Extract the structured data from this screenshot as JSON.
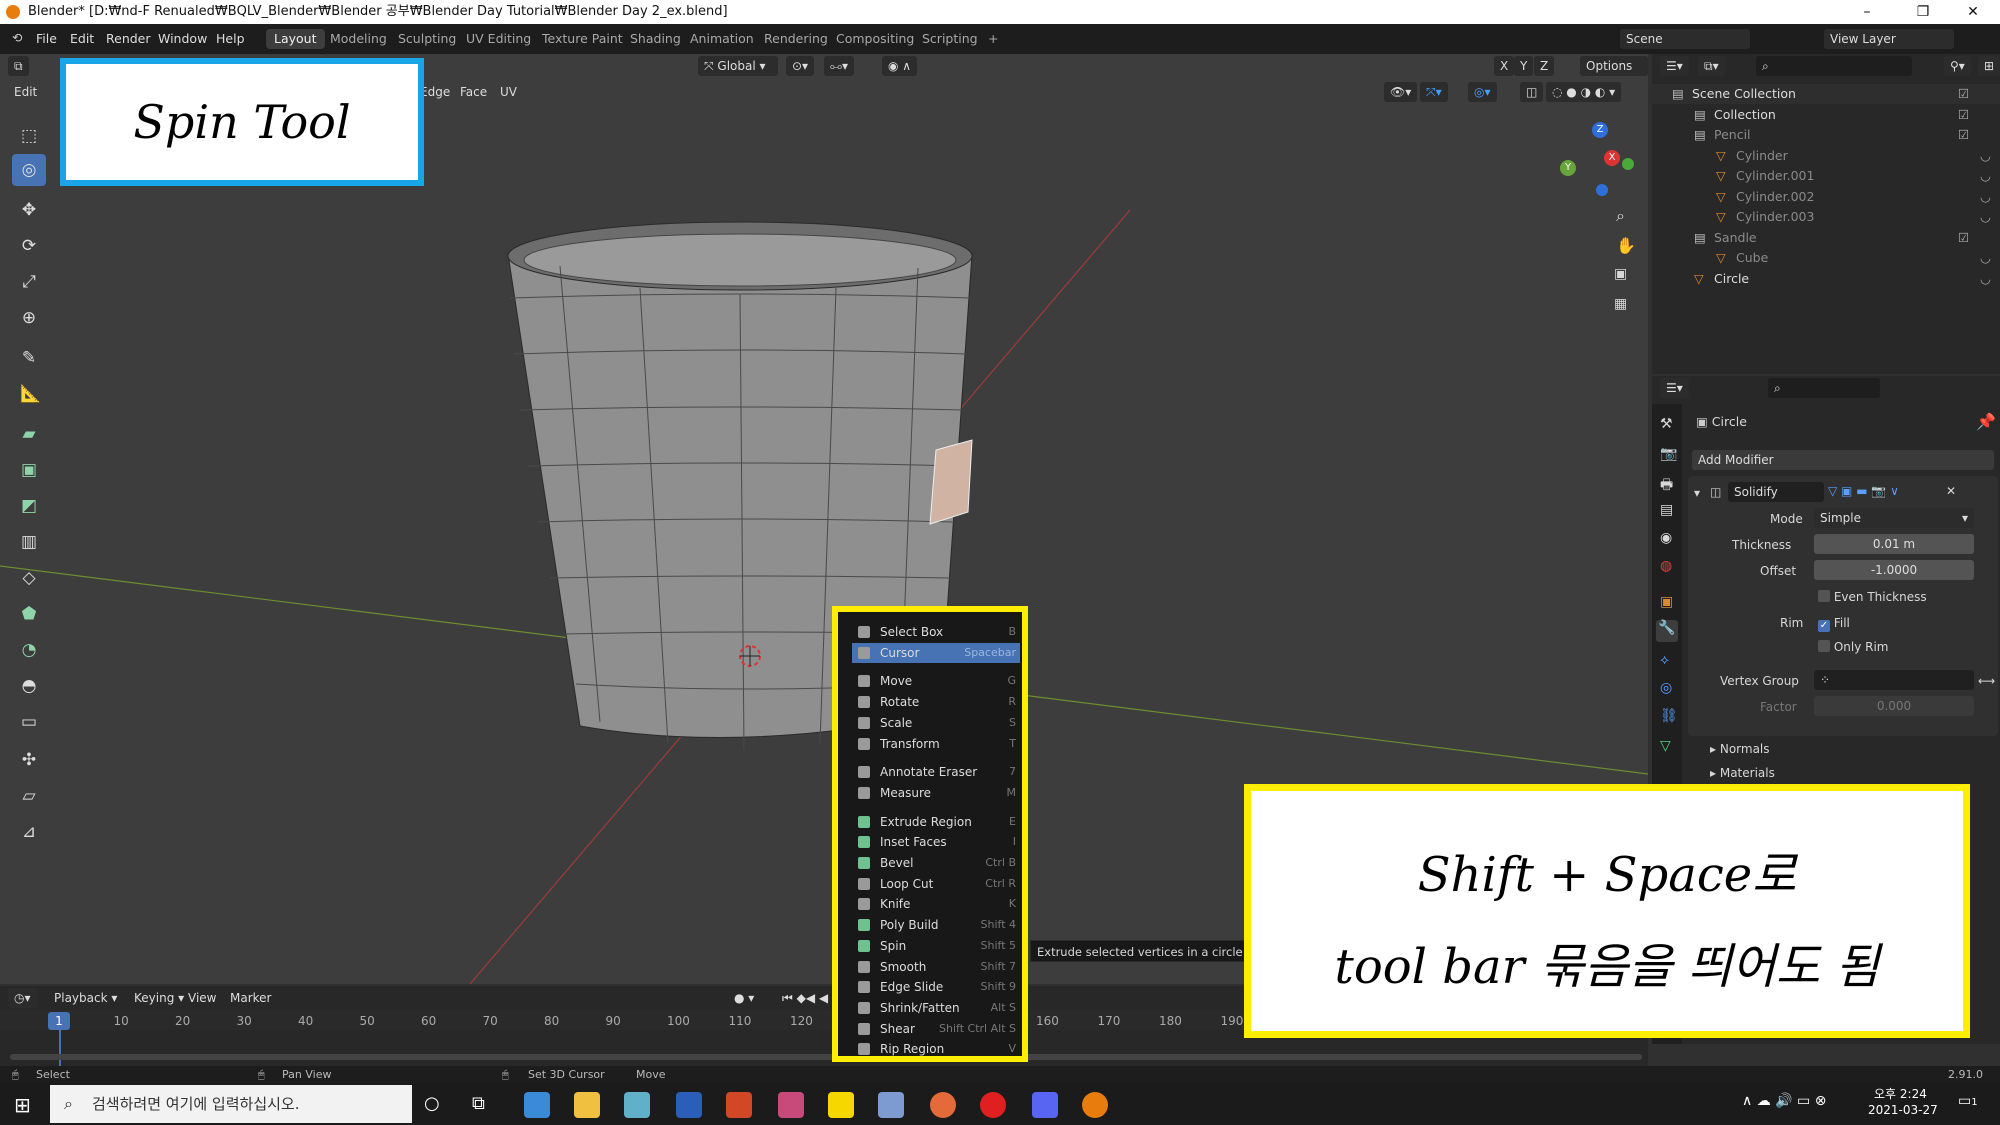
{
  "window": {
    "title": "Blender* [D:₩nd-F Renualed₩BQLV_Blender₩Blender 공부₩Blender Day Tutorial₩Blender Day 2_ex.blend]",
    "minimize": "–",
    "maximize": "❐",
    "close": "✕"
  },
  "menubar": {
    "items": [
      "File",
      "Edit",
      "Render",
      "Window",
      "Help"
    ],
    "workspaces": [
      "Layout",
      "Modeling",
      "Sculpting",
      "UV Editing",
      "Texture Paint",
      "Shading",
      "Animation",
      "Rendering",
      "Compositing",
      "Scripting"
    ],
    "add_ws": "+",
    "scene": "Scene",
    "view_layer": "View Layer"
  },
  "viewport_header": {
    "mode": "Edit",
    "select_modes": [
      "Edge",
      "Face",
      "UV"
    ],
    "orientation": "Global",
    "options": "Options",
    "axes": [
      "X",
      "Y",
      "Z"
    ]
  },
  "gizmo": {
    "z": "Z",
    "x": "X",
    "y": "Y"
  },
  "outliner": {
    "search": "",
    "rows": [
      {
        "label": "Scene Collection",
        "level": 0,
        "dim": false
      },
      {
        "label": "Collection",
        "level": 1,
        "dim": false
      },
      {
        "label": "Pencil",
        "level": 1,
        "dim": true
      },
      {
        "label": "Cylinder",
        "level": 2,
        "dim": true
      },
      {
        "label": "Cylinder.001",
        "level": 2,
        "dim": true
      },
      {
        "label": "Cylinder.002",
        "level": 2,
        "dim": true
      },
      {
        "label": "Cylinder.003",
        "level": 2,
        "dim": true
      },
      {
        "label": "Sandle",
        "level": 1,
        "dim": true
      },
      {
        "label": "Cube",
        "level": 2,
        "dim": true
      },
      {
        "label": "Circle",
        "level": 1,
        "dim": false
      }
    ]
  },
  "properties": {
    "object": "Circle",
    "add_modifier": "Add Modifier",
    "modifier_name": "Solidify",
    "mode_label": "Mode",
    "mode_value": "Simple",
    "thickness_label": "Thickness",
    "thickness_value": "0.01 m",
    "offset_label": "Offset",
    "offset_value": "-1.0000",
    "even_thickness": "Even Thickness",
    "rim_label": "Rim",
    "fill": "Fill",
    "only_rim": "Only Rim",
    "vertex_group_label": "Vertex Group",
    "factor_label": "Factor",
    "factor_value": "0.000",
    "sections": [
      "Normals",
      "Materials"
    ]
  },
  "pie_menu": {
    "items": [
      {
        "label": "Select Box",
        "shortcut": "B",
        "sel": false,
        "color": "#9a9a9a"
      },
      {
        "label": "Cursor",
        "shortcut": "Spacebar",
        "sel": true,
        "color": "#9a9a9a"
      },
      {
        "label": "Move",
        "shortcut": "G",
        "sel": false,
        "color": "#9a9a9a"
      },
      {
        "label": "Rotate",
        "shortcut": "R",
        "sel": false,
        "color": "#9a9a9a"
      },
      {
        "label": "Scale",
        "shortcut": "S",
        "sel": false,
        "color": "#9a9a9a"
      },
      {
        "label": "Transform",
        "shortcut": "T",
        "sel": false,
        "color": "#9a9a9a"
      },
      {
        "label": "Annotate Eraser",
        "shortcut": "7",
        "sel": false,
        "color": "#9a9a9a"
      },
      {
        "label": "Measure",
        "shortcut": "M",
        "sel": false,
        "color": "#9a9a9a"
      },
      {
        "label": "Extrude Region",
        "shortcut": "E",
        "sel": false,
        "color": "#6fc28f"
      },
      {
        "label": "Inset Faces",
        "shortcut": "I",
        "sel": false,
        "color": "#6fc28f"
      },
      {
        "label": "Bevel",
        "shortcut": "Ctrl B",
        "sel": false,
        "color": "#6fc28f"
      },
      {
        "label": "Loop Cut",
        "shortcut": "Ctrl R",
        "sel": false,
        "color": "#9a9a9a"
      },
      {
        "label": "Knife",
        "shortcut": "K",
        "sel": false,
        "color": "#9a9a9a"
      },
      {
        "label": "Poly Build",
        "shortcut": "Shift 4",
        "sel": false,
        "color": "#6fc28f"
      },
      {
        "label": "Spin",
        "shortcut": "Shift 5",
        "sel": false,
        "color": "#6fc28f"
      },
      {
        "label": "Smooth",
        "shortcut": "Shift 7",
        "sel": false,
        "color": "#9a9a9a"
      },
      {
        "label": "Edge Slide",
        "shortcut": "Shift 9",
        "sel": false,
        "color": "#9a9a9a"
      },
      {
        "label": "Shrink/Fatten",
        "shortcut": "Alt S",
        "sel": false,
        "color": "#9a9a9a"
      },
      {
        "label": "Shear",
        "shortcut": "Shift Ctrl Alt S",
        "sel": false,
        "color": "#9a9a9a"
      },
      {
        "label": "Rip Region",
        "shortcut": "V",
        "sel": false,
        "color": "#9a9a9a"
      }
    ]
  },
  "tooltip": "Extrude selected vertices in a circle aro",
  "timeline": {
    "menus": [
      "Playback",
      "Keying",
      "View",
      "Marker"
    ],
    "current_frame": "1",
    "frames": [
      "10",
      "20",
      "30",
      "40",
      "50",
      "60",
      "70",
      "80",
      "90",
      "100",
      "110",
      "120",
      "160",
      "170",
      "180",
      "190"
    ]
  },
  "statusbar": {
    "select": "Select",
    "pan": "Pan View",
    "cursor": "Set 3D Cursor",
    "move": "Move",
    "version": "2.91.0"
  },
  "taskbar": {
    "search_placeholder": "검색하려면 여기에 입력하십시오.",
    "time": "오후 2:24",
    "date": "2021-03-27",
    "notif": "1"
  },
  "annotations": {
    "spin_tool": "Spin Tool",
    "shift_space_line1": "Shift + Space로",
    "shift_space_line2": "tool bar 묶음을 띄어도 됨"
  }
}
